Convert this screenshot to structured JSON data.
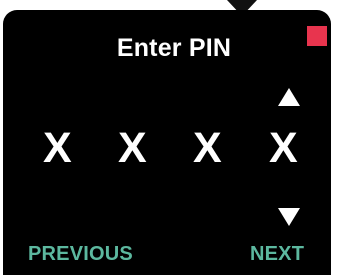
{
  "screen": {
    "title": "Enter PIN",
    "status_indicator_color": "#e8344e",
    "pin_digits": [
      "X",
      "X",
      "X",
      "X"
    ],
    "up_icon": "arrow-up-icon",
    "down_icon": "arrow-down-icon"
  },
  "nav": {
    "previous_label": "PREVIOUS",
    "next_label": "NEXT",
    "label_color": "#5cb89f"
  }
}
